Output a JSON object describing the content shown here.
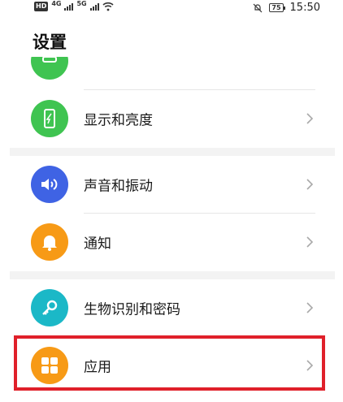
{
  "status_bar": {
    "hd_label": "HD",
    "sim1_network": "4G",
    "sim2_network": "5G",
    "battery_level": "75",
    "time": "15:50"
  },
  "page": {
    "title": "设置"
  },
  "settings_items": [
    {
      "label": "显示和亮度",
      "icon": "phone-brightness-icon",
      "icon_color": "#3fc451"
    },
    {
      "label": "声音和振动",
      "icon": "speaker-icon",
      "icon_color": "#3f63e4"
    },
    {
      "label": "通知",
      "icon": "bell-icon",
      "icon_color": "#f79a16"
    },
    {
      "label": "生物识别和密码",
      "icon": "key-icon",
      "icon_color": "#1bb8c7"
    },
    {
      "label": "应用",
      "icon": "apps-grid-icon",
      "icon_color": "#f79a16"
    }
  ],
  "colors": {
    "highlight_border": "#e0202a",
    "section_gap": "#f3f3f3"
  }
}
